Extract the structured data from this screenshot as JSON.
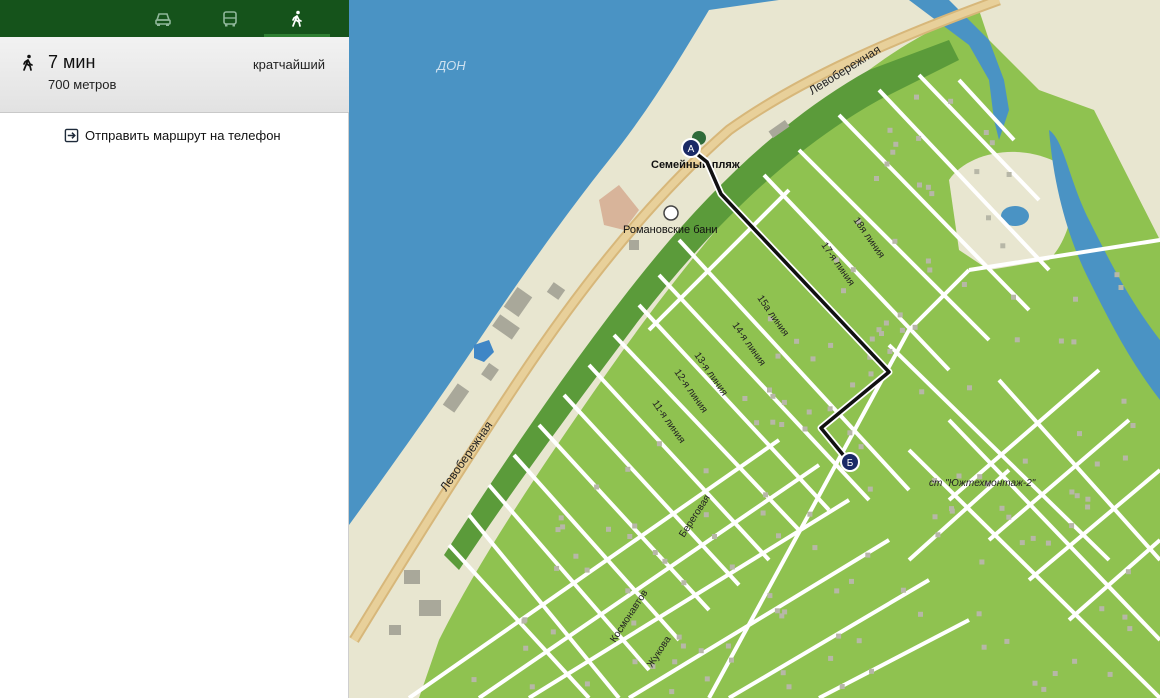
{
  "modes": [
    {
      "name": "car-mode-button",
      "icon": "car-icon",
      "active": false
    },
    {
      "name": "bus-mode-button",
      "icon": "bus-icon",
      "active": false
    },
    {
      "name": "walk-mode-button",
      "icon": "walk-icon",
      "active": true
    }
  ],
  "route": {
    "duration": "7 мин",
    "distance": "700 метров",
    "type": "кратчайший"
  },
  "send_to_phone": "Отправить маршрут на телефон",
  "map": {
    "water_label": "ДОН",
    "road_left_bank_1": "Левобережная",
    "road_left_bank_2": "Левобережная",
    "poi_beach": "Семейный пляж",
    "poi_baths": "Романовские бани",
    "streets": {
      "l18": "18я линия",
      "l17": "17-я линия",
      "l15": "15а линия",
      "l14": "14-я линия",
      "l13": "13-я линия",
      "l12": "12-я линия",
      "l11": "11-я линия",
      "beregovaya": "Береговая",
      "kosmonavtov": "Космонавтов",
      "zhukova": "Жукова"
    },
    "settlement": "ст \"Южтехмонтаж-2\"",
    "marker_start": "A",
    "marker_end": "Б",
    "colors": {
      "water": "#4a93c4",
      "green": "#8fc250",
      "dark_green": "#5b9b3a",
      "road": "#e3c98f",
      "sand": "#e8e6d0",
      "route": "#111111"
    }
  }
}
